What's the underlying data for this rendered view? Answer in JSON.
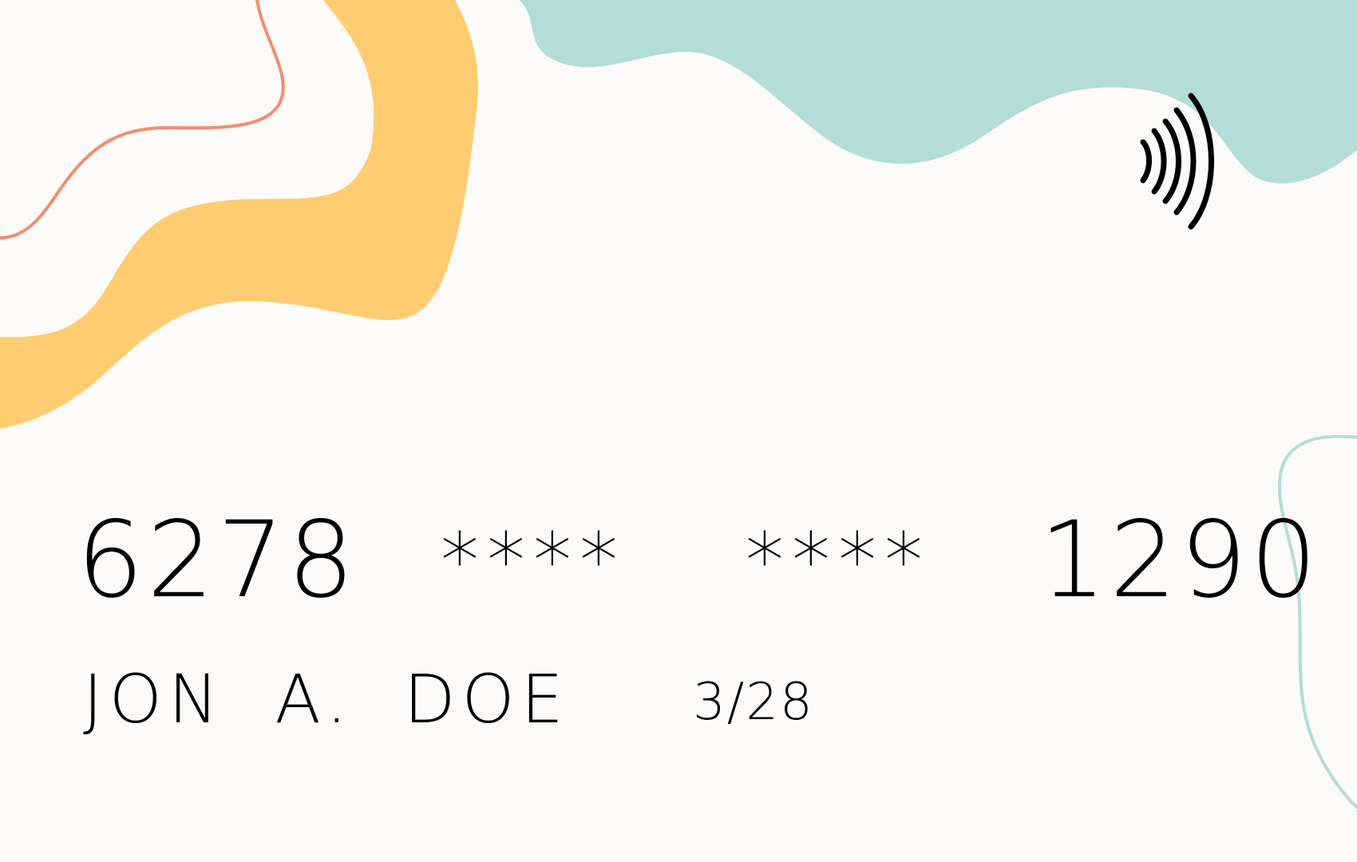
{
  "card": {
    "number_groups": [
      "6278",
      "****",
      "****",
      "1290"
    ],
    "holder_name": "JON A. DOE",
    "expiry": "3/28"
  },
  "icons": {
    "contactless": "contactless-payment-icon"
  },
  "colors": {
    "background": "#fcfbf9",
    "coral": "#f28e6e",
    "mustard": "#fecd72",
    "teal": "#b3ddd6",
    "text": "#000000"
  }
}
